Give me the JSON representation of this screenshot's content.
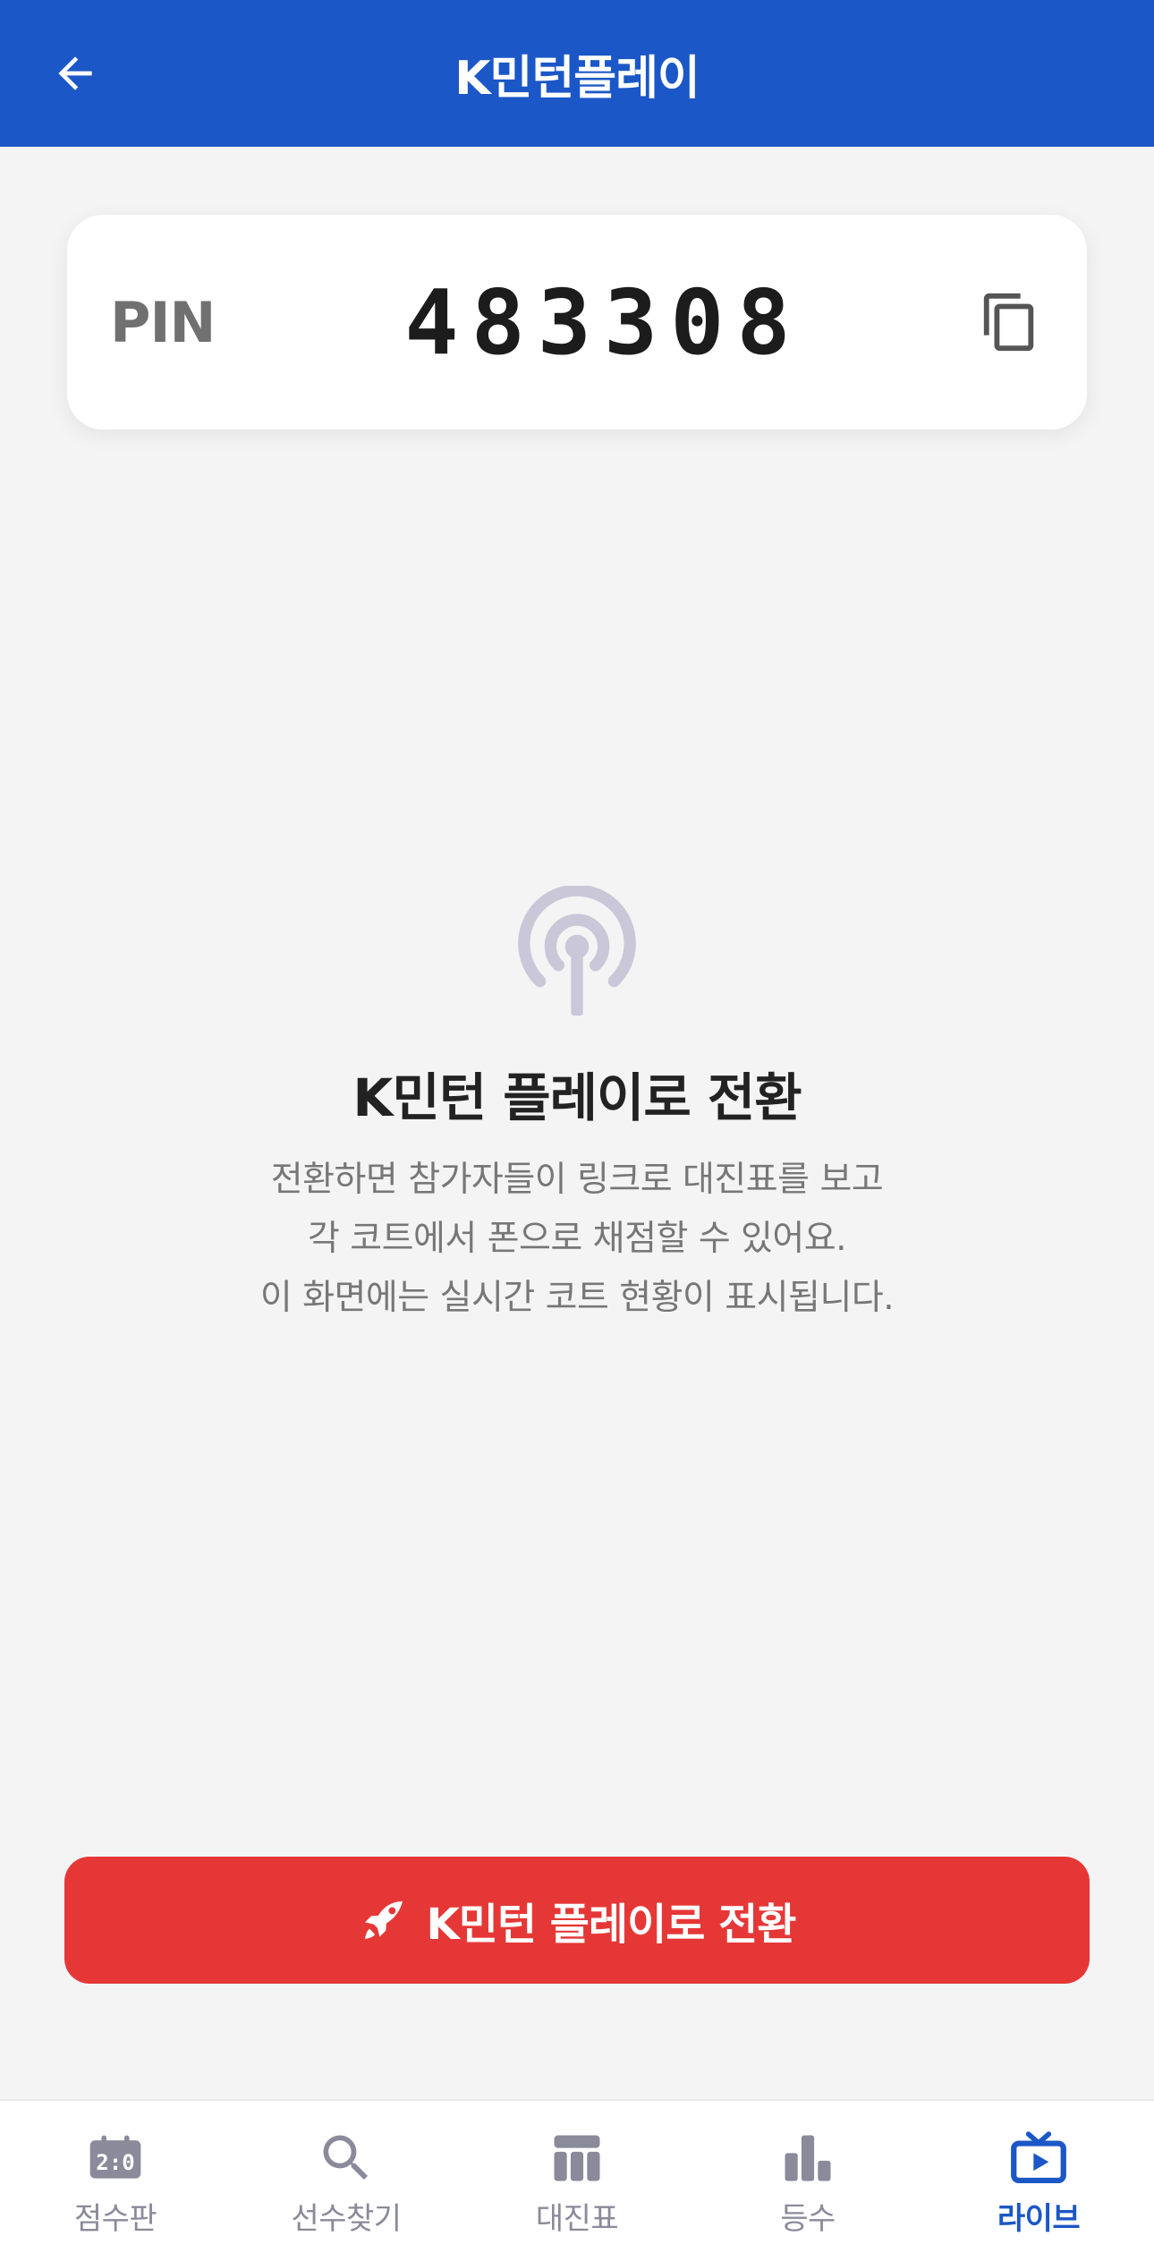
{
  "header": {
    "title": "K민턴플레이"
  },
  "pin": {
    "label": "PIN",
    "value": "483308"
  },
  "empty_state": {
    "icon": "broadcast-icon",
    "title": "K민턴 플레이로 전환",
    "description_lines": [
      "전환하면 참가자들이 링크로 대진표를 보고",
      "각 코트에서 폰으로 채점할 수 있어요.",
      "이 화면에는 실시간 코트 현황이 표시됩니다."
    ]
  },
  "cta": {
    "label": "K민턴 플레이로 전환",
    "icon": "rocket-icon"
  },
  "tabs": [
    {
      "label": "점수판",
      "icon": "scoreboard-icon",
      "active": false
    },
    {
      "label": "선수찾기",
      "icon": "search-icon",
      "active": false
    },
    {
      "label": "대진표",
      "icon": "bracket-icon",
      "active": false
    },
    {
      "label": "등수",
      "icon": "ranking-icon",
      "active": false
    },
    {
      "label": "라이브",
      "icon": "live-tv-icon",
      "active": true
    }
  ],
  "colors": {
    "primary": "#1b57c6",
    "cta": "#e63737",
    "inactive_icon": "#8a8a9a",
    "broadcast_icon": "#c9c7d8"
  }
}
